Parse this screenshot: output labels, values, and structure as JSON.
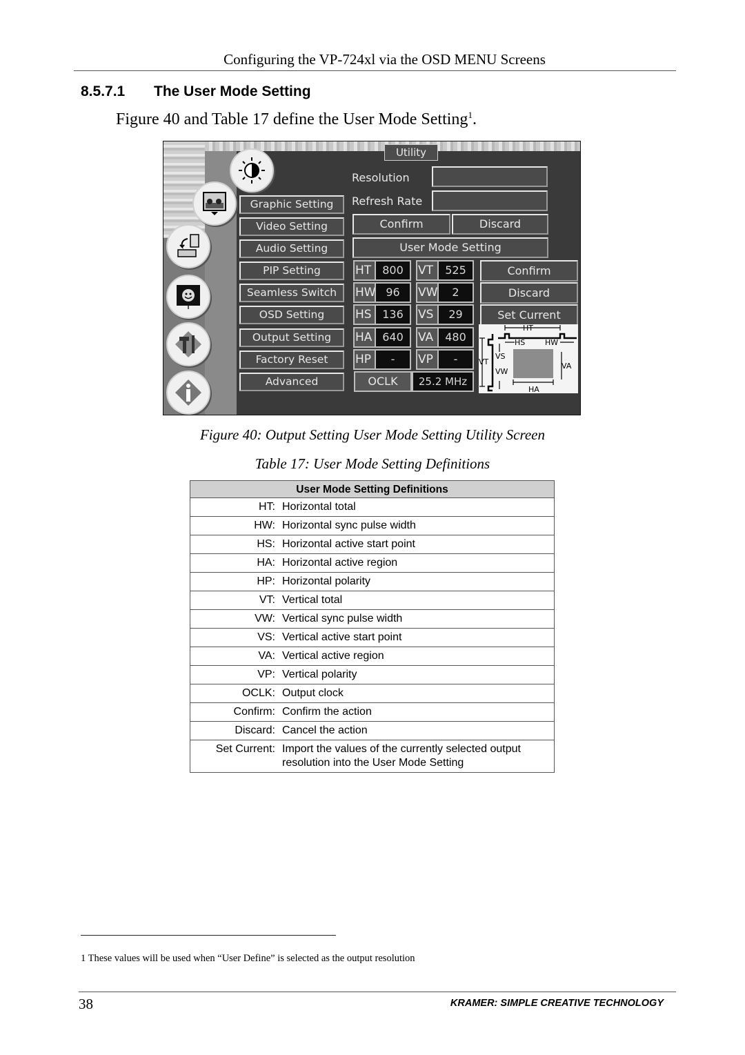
{
  "running_header": "Configuring the VP-724xl via the OSD MENU Screens",
  "section": {
    "number": "8.5.7.1",
    "title": "The User Mode Setting"
  },
  "intro": {
    "text": "Figure 40 and Table 17 define the User Mode Setting",
    "footnote_ref": "1",
    "end": "."
  },
  "osd": {
    "icons": [
      "brightness-contrast",
      "picture-display",
      "input-source",
      "monitor-adjust",
      "tools",
      "info"
    ],
    "menu": [
      "Graphic Setting",
      "Video Setting",
      "Audio Setting",
      "PIP Setting",
      "Seamless Switch",
      "OSD Setting",
      "Output Setting",
      "Factory Reset",
      "Advanced"
    ],
    "tab": "Utility",
    "resolution_label": "Resolution",
    "resolution_value": "",
    "refresh_label": "Refresh Rate",
    "refresh_value": "",
    "confirm": "Confirm",
    "discard": "Discard",
    "user_mode_setting": "User Mode Setting",
    "params": [
      {
        "name": "HT",
        "value": "800"
      },
      {
        "name": "HW",
        "value": "96"
      },
      {
        "name": "HS",
        "value": "136"
      },
      {
        "name": "HA",
        "value": "640"
      },
      {
        "name": "HP",
        "value": "-"
      },
      {
        "name": "VT",
        "value": "525"
      },
      {
        "name": "VW",
        "value": "2"
      },
      {
        "name": "VS",
        "value": "29"
      },
      {
        "name": "VA",
        "value": "480"
      },
      {
        "name": "VP",
        "value": "-"
      }
    ],
    "oclk_label": "OCLK",
    "oclk_value": "25.2 MHz",
    "right_confirm": "Confirm",
    "right_discard": "Discard",
    "set_current": "Set Current",
    "diagram_labels": {
      "ht": "HT",
      "hs": "HS",
      "hw": "HW",
      "vt": "VT",
      "vs": "VS",
      "vw": "VW",
      "va": "VA",
      "ha": "HA"
    }
  },
  "figure_caption": "Figure 40: Output Setting User Mode Setting Utility Screen",
  "table_caption": "Table 17: User Mode Setting Definitions",
  "table": {
    "header": "User Mode Setting Definitions",
    "rows": [
      {
        "term": "HT:",
        "desc": "Horizontal total"
      },
      {
        "term": "HW:",
        "desc": "Horizontal sync pulse width"
      },
      {
        "term": "HS:",
        "desc": "Horizontal active start point"
      },
      {
        "term": "HA:",
        "desc": "Horizontal active region"
      },
      {
        "term": "HP:",
        "desc": "Horizontal polarity"
      },
      {
        "term": "VT:",
        "desc": "Vertical total"
      },
      {
        "term": "VW:",
        "desc": "Vertical sync pulse width"
      },
      {
        "term": "VS:",
        "desc": "Vertical active start point"
      },
      {
        "term": "VA:",
        "desc": "Vertical active region"
      },
      {
        "term": "VP:",
        "desc": "Vertical polarity"
      },
      {
        "term": "OCLK:",
        "desc": "Output clock"
      },
      {
        "term": "Confirm:",
        "desc": "Confirm the action"
      },
      {
        "term": "Discard:",
        "desc": "Cancel the action"
      },
      {
        "term": "Set Current:",
        "desc": "Import the values of the currently selected output resolution into the User Mode Setting"
      }
    ]
  },
  "footnote": "1 These values will be used when “User Define” is selected as the output resolution",
  "footer": {
    "page_number": "38",
    "brand": "KRAMER:  SIMPLE CREATIVE TECHNOLOGY"
  }
}
